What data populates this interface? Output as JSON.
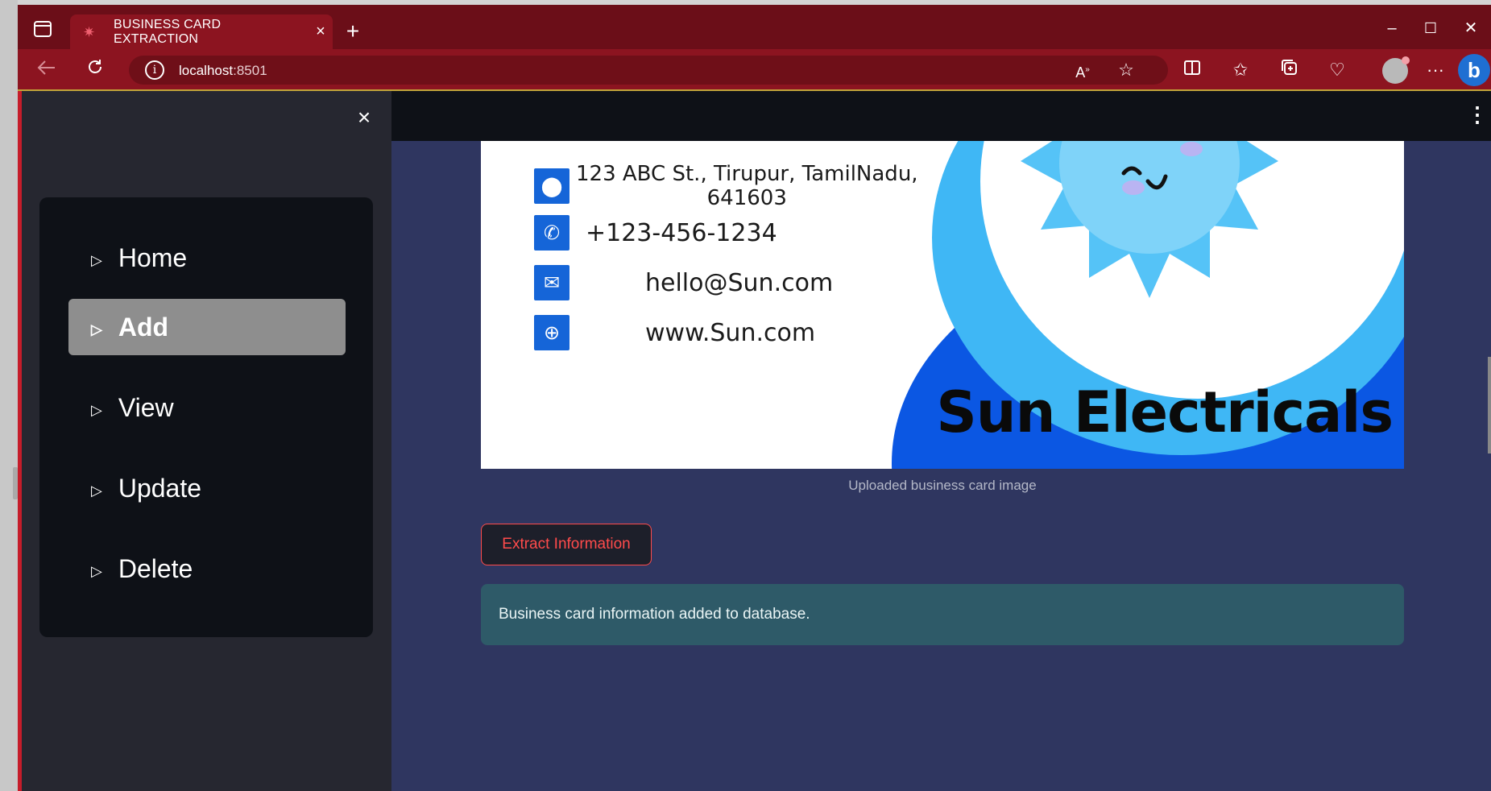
{
  "browser": {
    "tab_title": "BUSINESS CARD EXTRACTION",
    "tab_close": "×",
    "new_tab": "+",
    "url_host": "localhost",
    "url_port": ":8501",
    "window_controls": {
      "minimize": "–",
      "maximize": "☐",
      "close": "✕"
    },
    "toolbar_icons": [
      "back-icon",
      "refresh-icon",
      "read-aloud-icon",
      "favorite-star-icon",
      "split-screen-icon",
      "favorites-icon",
      "collections-icon",
      "health-icon",
      "profile-icon",
      "more-icon",
      "bing-icon"
    ],
    "colors": {
      "tabbar": "#6b0e18",
      "toolbar": "#8c1420"
    }
  },
  "sidebar": {
    "close_label": "×",
    "items": [
      {
        "label": "Home",
        "active": false
      },
      {
        "label": "Add",
        "active": true
      },
      {
        "label": "View",
        "active": false
      },
      {
        "label": "Update",
        "active": false
      },
      {
        "label": "Delete",
        "active": false
      }
    ]
  },
  "header": {
    "menu_label": "⋮"
  },
  "card": {
    "address_line1": "123 ABC St., Tirupur, TamilNadu,",
    "address_line2": "641603",
    "phone": "+123-456-1234",
    "email": "hello@Sun.com",
    "website": "www.Sun.com",
    "company": "Sun Electricals"
  },
  "main": {
    "caption": "Uploaded business card image",
    "extract_button": "Extract Information",
    "success_message": "Business card information added to database."
  },
  "colors": {
    "app_bg": "#2f3660",
    "sidebar_bg": "#262730",
    "menu_bg": "#0e1117",
    "active_item": "#8e8e8e",
    "accent_red": "#ff4b4b",
    "success_bg": "#2e5a68"
  }
}
